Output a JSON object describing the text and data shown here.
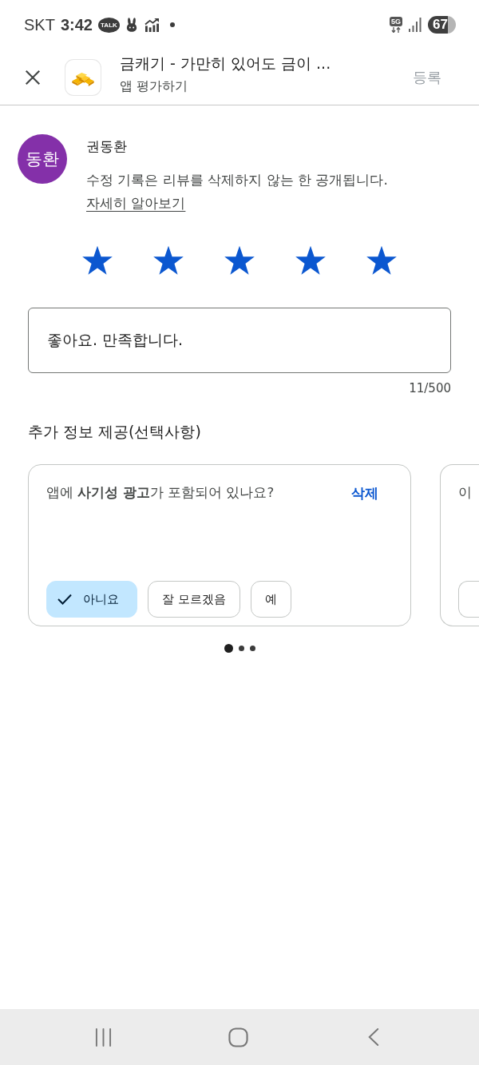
{
  "status_bar": {
    "carrier": "SKT",
    "time": "3:42",
    "chat_badge": "TALK",
    "network_type": "5G",
    "battery": "67"
  },
  "header": {
    "title": "금캐기 - 가만히 있어도 금이 ...",
    "subtitle": "앱 평가하기",
    "submit": {
      "label": "등록",
      "disabled": true
    }
  },
  "reviewer": {
    "avatar_text": "동환",
    "name": "권동환",
    "notice": "수정 기록은 리뷰를 삭제하지 않는 한 공개됩니다.",
    "notice_link": "자세히 알아보기"
  },
  "rating": {
    "stars": 5
  },
  "review": {
    "value": "좋아요. 만족합니다.",
    "counter": "11/500"
  },
  "additional_info": {
    "title": "추가 정보 제공(선택사항)",
    "questions": [
      {
        "text": "앱에 **사기성 광고**가 포함되어 있나요?",
        "clear_label": "삭제",
        "options": [
          {
            "label": "아니요",
            "selected": true
          },
          {
            "label": "잘 모르겠음",
            "selected": false
          },
          {
            "label": "예",
            "selected": false
          }
        ]
      },
      {
        "text": "이",
        "options": [
          {
            "selected": false
          }
        ]
      }
    ],
    "pager": [
      {
        "selected": true
      },
      {
        "selected": false
      },
      {
        "selected": false
      }
    ]
  }
}
